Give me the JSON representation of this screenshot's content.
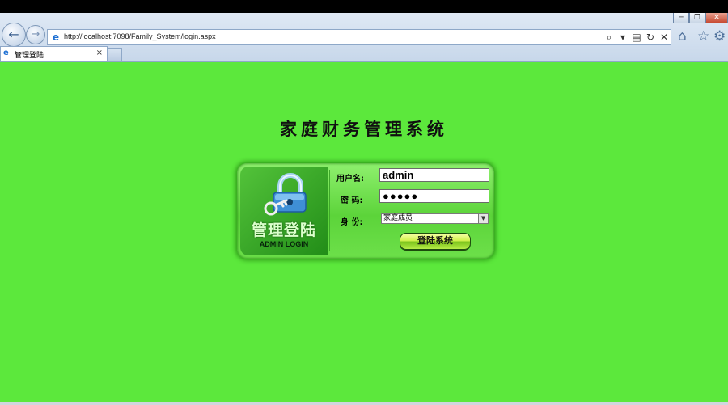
{
  "browser": {
    "url": "http://localhost:7098/Family_System/login.aspx",
    "tab_title": "管理登陆",
    "tab_close": "×",
    "icons": {
      "back": "←",
      "forward": "→",
      "search": "⌕",
      "dropdown": "▾",
      "compat": "▤",
      "refresh": "↻",
      "stop": "✕",
      "home": "⌂",
      "favorites": "☆",
      "tools": "⚙",
      "minimize": "─",
      "restore": "❐",
      "close": "✕"
    }
  },
  "page": {
    "background_color": "#5ce83c",
    "title": "家庭财务管理系统",
    "panel": {
      "heading": "管理登陆",
      "subheading": "ADMIN LOGIN",
      "username_label": "用户名:",
      "username_value": "admin",
      "password_label": "密 码:",
      "password_value": "●●●●●",
      "role_label": "身 份:",
      "role_selected": "家庭成员",
      "login_button": "登陆系统"
    }
  }
}
